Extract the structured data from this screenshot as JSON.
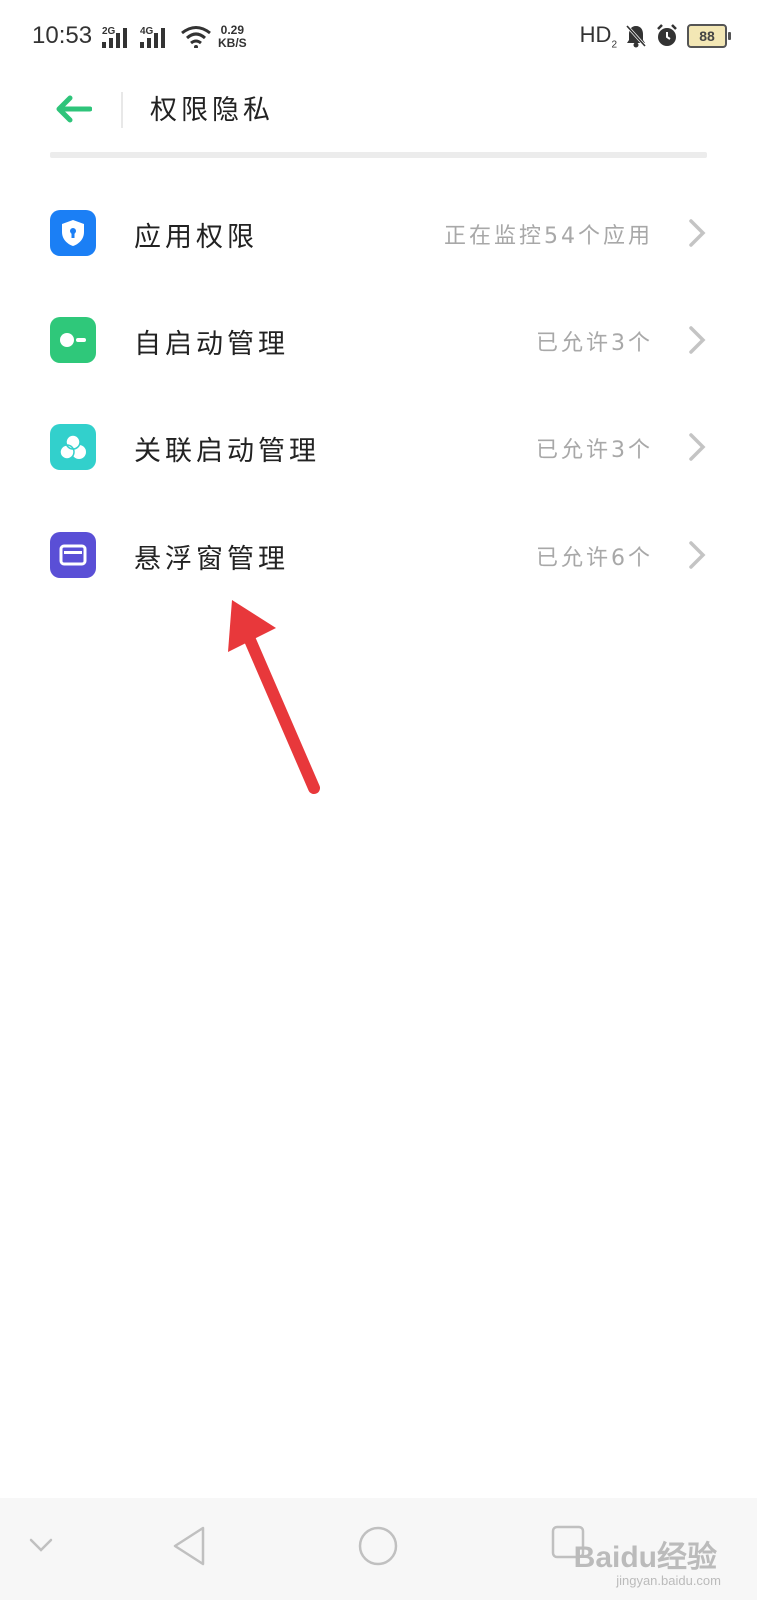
{
  "status_bar": {
    "time": "10:53",
    "sim1": "2G",
    "sim2": "4G",
    "speed_value": "0.29",
    "speed_unit": "KB/S",
    "hd": "HD",
    "hd_sub": "2",
    "battery": "88"
  },
  "header": {
    "title": "权限隐私",
    "accent_color": "#2ec47a"
  },
  "rows": [
    {
      "label": "应用权限",
      "value": "正在监控54个应用",
      "icon": "shield-lock-icon",
      "color": "#1b7ff5"
    },
    {
      "label": "自启动管理",
      "value": "已允许3个",
      "icon": "toggle-key-icon",
      "color": "#2fc87a"
    },
    {
      "label": "关联启动管理",
      "value": "已允许3个",
      "icon": "cluster-circles-icon",
      "color": "#32d0cc"
    },
    {
      "label": "悬浮窗管理",
      "value": "已允许6个",
      "icon": "floating-window-icon",
      "color": "#5a4fd6"
    }
  ],
  "nav": {
    "items": [
      "chevron-down-icon",
      "back-triangle-icon",
      "home-circle-icon",
      "recents-square-icon"
    ]
  },
  "watermark": {
    "text": "Baidu经验",
    "sub": "jingyan.baidu.com"
  },
  "annotation": {
    "arrow_color": "#e8383b"
  }
}
